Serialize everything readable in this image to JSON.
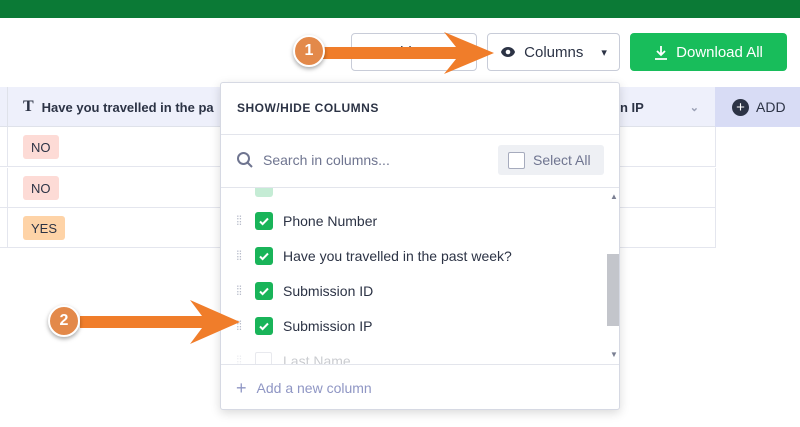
{
  "toolbar": {
    "hide_label": "Hide",
    "columns_label": "Columns",
    "download_label": "Download All"
  },
  "table": {
    "header_partial": "Have you travelled in the pa",
    "header_ip_partial": "n IP",
    "add_label": "ADD",
    "rows": [
      "NO",
      "NO",
      "YES"
    ]
  },
  "panel": {
    "title": "SHOW/HIDE COLUMNS",
    "search_placeholder": "Search in columns...",
    "select_all": "Select All",
    "items": [
      {
        "label": "Phone Number",
        "checked": true
      },
      {
        "label": "Have you travelled in the past week?",
        "checked": true
      },
      {
        "label": "Submission ID",
        "checked": true
      },
      {
        "label": "Submission IP",
        "checked": true
      },
      {
        "label": "Last Name",
        "checked": false
      }
    ],
    "add_column": "Add a new column"
  },
  "annotations": {
    "marker_1": "1",
    "marker_2": "2"
  },
  "colors": {
    "topbar": "#0b7a36",
    "download": "#18bd5b",
    "checkbox": "#19b459",
    "marker": "#e3894a",
    "arrow": "#f07d2a"
  }
}
